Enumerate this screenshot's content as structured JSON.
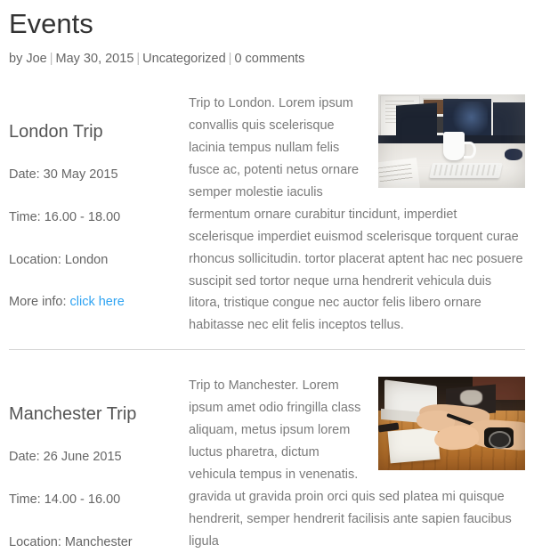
{
  "post": {
    "title": "Events",
    "meta": {
      "author": "by Joe",
      "date": "May 30, 2015",
      "category": "Uncategorized",
      "comments": "0 comments",
      "separator": "|"
    }
  },
  "events": [
    {
      "title": "London Trip",
      "details": [
        {
          "label": "Date: 30 May 2015"
        },
        {
          "label": "Time: 16.00 - 18.00"
        },
        {
          "label": "Location: London"
        }
      ],
      "more_info_label": "More info:",
      "more_info_link": "click here",
      "body": "Trip to London. Lorem ipsum convallis quis scelerisque lacinia tempus nullam felis fusce ac, potenti netus ornare semper molestie iaculis fermentum ornare curabitur tincidunt, imperdiet scelerisque imperdiet euismod scelerisque torquent curae rhoncus sollicitudin. tortor placerat aptent hac nec posuere suscipit sed tortor neque urna hendrerit vehicula duis litora, tristique congue nec auctor felis libero ornare habitasse nec elit felis inceptos tellus.",
      "photo": "desk-with-monitors-mug-and-keyboard-photo"
    },
    {
      "title": "Manchester Trip",
      "details": [
        {
          "label": "Date: 26 June 2015"
        },
        {
          "label": "Time: 14.00 - 16.00"
        },
        {
          "label": "Location: Manchester"
        }
      ],
      "more_info_label": "",
      "more_info_link": "",
      "body": "Trip to Manchester.  Lorem ipsum amet odio fringilla class aliquam, metus ipsum lorem luctus pharetra, dictum vehicula tempus in venenatis. gravida ut gravida proin orci quis sed platea mi quisque hendrerit, semper hendrerit facilisis ante sapien faucibus ligula",
      "photo": "hands-writing-beside-laptop-photo"
    }
  ],
  "colors": {
    "link": "#2ea3f2",
    "heading": "#333333",
    "meta": "#666666",
    "body": "#7a7a7a",
    "divider": "#d8d8d8"
  }
}
